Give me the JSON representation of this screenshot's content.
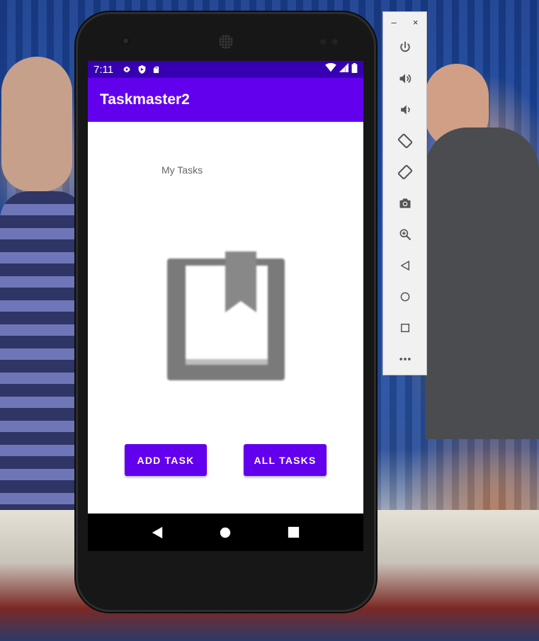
{
  "status_bar": {
    "time": "7:11",
    "icons_left": [
      "settings-icon",
      "shield-icon",
      "sd-card-icon"
    ],
    "icons_right": [
      "wifi-icon",
      "signal-icon",
      "battery-icon"
    ]
  },
  "app_bar": {
    "title": "Taskmaster2"
  },
  "main": {
    "heading": "My Tasks",
    "hero_icon": "bookmark-book-icon",
    "add_task_label": "ADD TASK",
    "all_tasks_label": "ALL TASKS"
  },
  "nav_bar": {
    "buttons": [
      "back-icon",
      "home-icon",
      "recents-icon"
    ]
  },
  "emulator_toolbar": {
    "minimize_label": "–",
    "close_label": "×",
    "controls": [
      "power-icon",
      "volume-up-icon",
      "volume-down-icon",
      "rotate-left-icon",
      "rotate-right-icon",
      "camera-icon",
      "zoom-icon",
      "back-icon",
      "home-icon",
      "overview-icon",
      "more-icon"
    ],
    "more_label": "•••"
  },
  "colors": {
    "status_bar": "#3700b3",
    "app_bar": "#6200ee",
    "button": "#6200ee"
  }
}
